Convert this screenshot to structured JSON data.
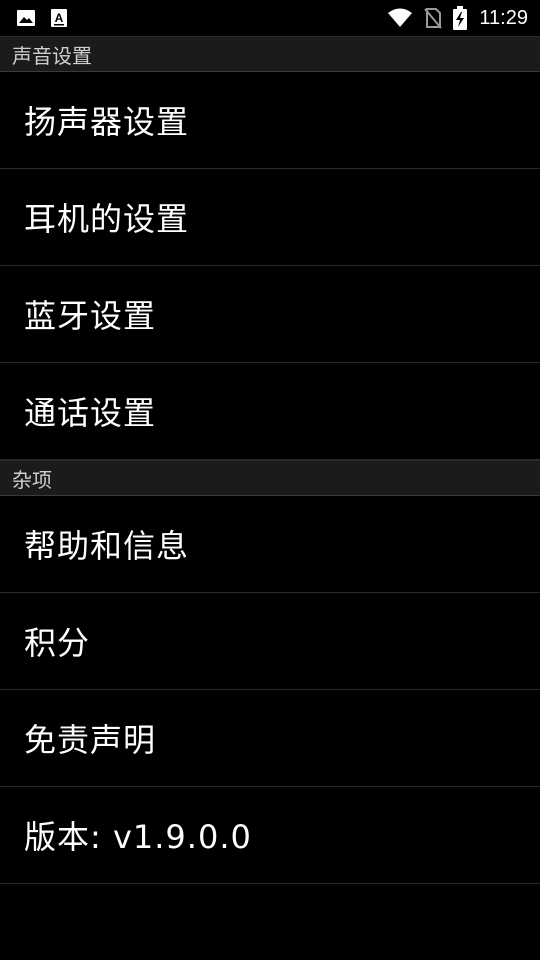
{
  "status_bar": {
    "left_icons": [
      "image-icon",
      "font-a-icon"
    ],
    "right_icons": [
      "wifi-icon",
      "no-sim-icon",
      "battery-charging-icon"
    ],
    "time": "11:29"
  },
  "sections": [
    {
      "header": "声音设置",
      "items": [
        {
          "label": "扬声器设置"
        },
        {
          "label": "耳机的设置"
        },
        {
          "label": "蓝牙设置"
        },
        {
          "label": "通话设置"
        }
      ]
    },
    {
      "header": "杂项",
      "items": [
        {
          "label": "帮助和信息"
        },
        {
          "label": "积分"
        },
        {
          "label": "免责声明"
        },
        {
          "label": "版本: v1.9.0.0"
        }
      ]
    }
  ],
  "colors": {
    "background": "#000000",
    "section_header_bg": "#1b1b1b",
    "section_header_text": "#cfcfcf",
    "divider": "#2a2a2a",
    "text": "#ffffff"
  }
}
